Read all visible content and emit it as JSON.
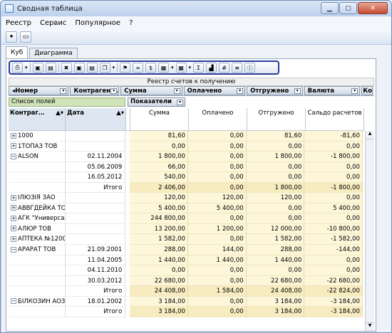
{
  "window": {
    "title": "Сводная таблица"
  },
  "menu": [
    "Реестр",
    "Сервис",
    "Популярное",
    "?"
  ],
  "tabs": [
    "Куб",
    "Диаграмма"
  ],
  "caption": "Реестр счетов к получению",
  "fields": [
    "Номер",
    "Контрагент …",
    "Сумма",
    "Оплачено",
    "Отгружено",
    "Валюта",
    "Ком"
  ],
  "field_list_label": "Список полей",
  "measures_label": "Показатели",
  "row_headers": [
    "Контраг…",
    "Дата"
  ],
  "columns": [
    "Сумма",
    "Оплачено",
    "Отгружено",
    "Сальдо расчетов"
  ],
  "rows": [
    {
      "kind": "group",
      "label": "1000",
      "date": "",
      "v": [
        "81,60",
        "0,00",
        "81,60",
        "-81,60"
      ],
      "sign": "+"
    },
    {
      "kind": "group",
      "label": "1ТОПАЗ ТОВ",
      "date": "",
      "v": [
        "0,00",
        "0,00",
        "0,00",
        "0,00"
      ],
      "sign": "+"
    },
    {
      "kind": "group",
      "label": "ALSON",
      "date": "02.11.2004",
      "v": [
        "1 800,00",
        "0,00",
        "1 800,00",
        "-1 800,00"
      ],
      "sign": "−"
    },
    {
      "kind": "sub",
      "label": "",
      "date": "05.06.2009",
      "v": [
        "66,00",
        "0,00",
        "0,00",
        "0,00"
      ]
    },
    {
      "kind": "sub",
      "label": "",
      "date": "16.05.2012",
      "v": [
        "540,00",
        "0,00",
        "0,00",
        "0,00"
      ]
    },
    {
      "kind": "total",
      "label": "",
      "date": "Итого",
      "v": [
        "2 406,00",
        "0,00",
        "1 800,00",
        "-1 800,00"
      ]
    },
    {
      "kind": "group",
      "label": "ІЛЮЗІЯ ЗАО",
      "date": "",
      "v": [
        "120,00",
        "120,00",
        "120,00",
        "0,00"
      ],
      "sign": "+"
    },
    {
      "kind": "group",
      "label": "АВВГДЕЙКА ТОВ",
      "date": "",
      "v": [
        "5 400,00",
        "5 400,00",
        "0,00",
        "5 400,00"
      ],
      "sign": "+"
    },
    {
      "kind": "group",
      "label": "АГК \"Универсал\"",
      "date": "",
      "v": [
        "244 800,00",
        "0,00",
        "0,00",
        "0,00"
      ],
      "sign": "+"
    },
    {
      "kind": "group",
      "label": "АЛЮР ТОВ",
      "date": "",
      "v": [
        "13 200,00",
        "1 200,00",
        "12 000,00",
        "-10 800,00"
      ],
      "sign": "+"
    },
    {
      "kind": "group",
      "label": "АПТЕКА №1200",
      "date": "",
      "v": [
        "1 582,00",
        "0,00",
        "1 582,00",
        "-1 582,00"
      ],
      "sign": "+"
    },
    {
      "kind": "group",
      "label": "АРАРАТ ТОВ",
      "date": "21.09.2001",
      "v": [
        "288,00",
        "144,00",
        "288,00",
        "-144,00"
      ],
      "sign": "−"
    },
    {
      "kind": "sub",
      "label": "",
      "date": "11.04.2005",
      "v": [
        "1 440,00",
        "1 440,00",
        "1 440,00",
        "0,00"
      ]
    },
    {
      "kind": "sub",
      "label": "",
      "date": "04.11.2010",
      "v": [
        "0,00",
        "0,00",
        "0,00",
        "0,00"
      ]
    },
    {
      "kind": "sub",
      "label": "",
      "date": "30.03.2012",
      "v": [
        "22 680,00",
        "0,00",
        "22 680,00",
        "-22 680,00"
      ]
    },
    {
      "kind": "total",
      "label": "",
      "date": "Итого",
      "v": [
        "24 408,00",
        "1 584,00",
        "24 408,00",
        "-22 824,00"
      ]
    },
    {
      "kind": "group",
      "label": "БІЛКОЗИН АОЗТ",
      "date": "18.01.2002",
      "v": [
        "3 184,00",
        "0,00",
        "3 184,00",
        "-3 184,00"
      ],
      "sign": "−"
    },
    {
      "kind": "total",
      "label": "",
      "date": "Итого",
      "v": [
        "3 184,00",
        "0,00",
        "3 184,00",
        "-3 184,00"
      ]
    }
  ]
}
